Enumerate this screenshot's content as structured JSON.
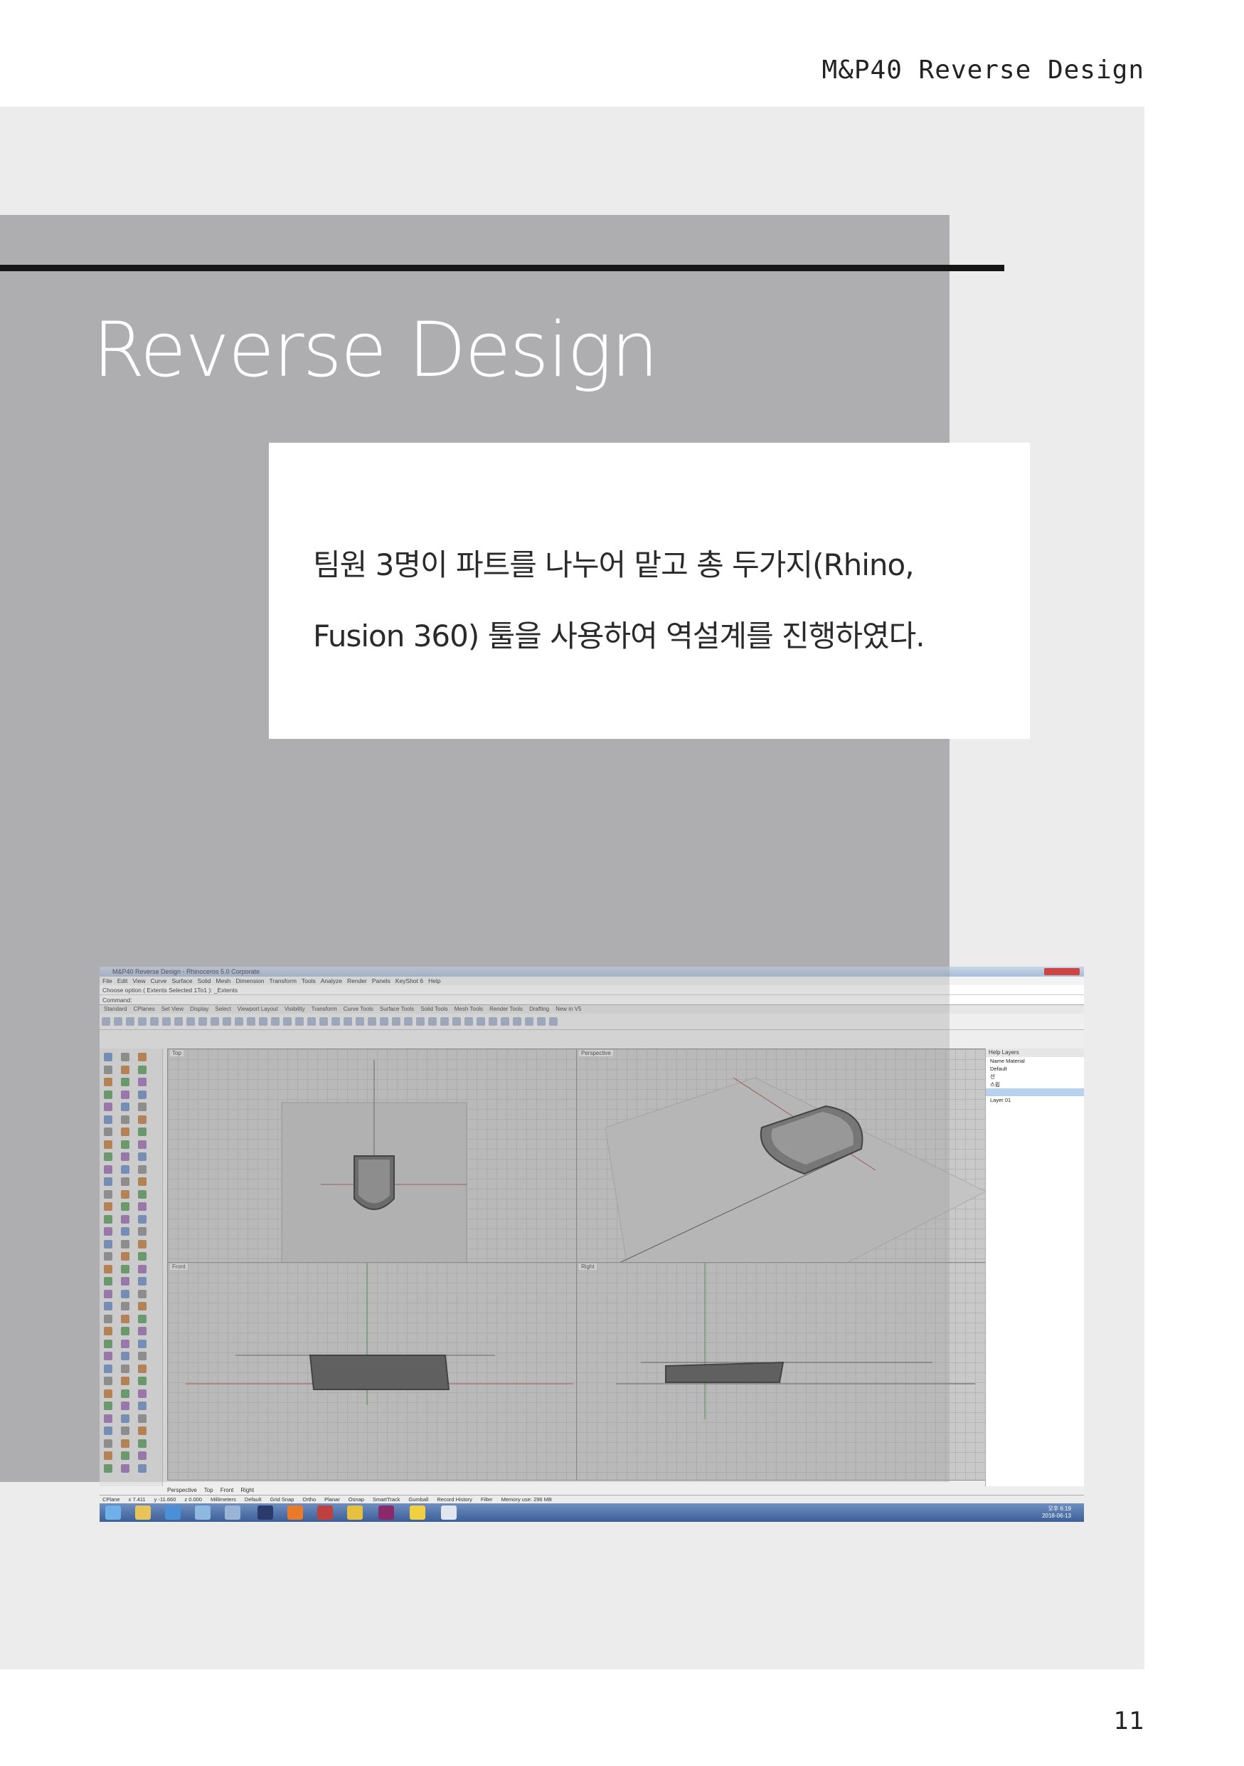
{
  "header": {
    "title": "M&P40 Reverse Design"
  },
  "section": {
    "title": "Reverse Design"
  },
  "body": {
    "line1": "팀원 3명이 파트를 나누어 맡고 총 두가지(Rhino,",
    "line2": "Fusion 360) 툴을 사용하여 역설계를 진행하였다."
  },
  "page_number": "11",
  "screenshot": {
    "window_title": "M&P40 Reverse Design - Rhinoceros 5.0 Corporate",
    "menu": [
      "File",
      "Edit",
      "View",
      "Curve",
      "Surface",
      "Solid",
      "Mesh",
      "Dimension",
      "Transform",
      "Tools",
      "Analyze",
      "Render",
      "Panels",
      "KeyShot 6",
      "Help"
    ],
    "command_history": "Choose option ( Extents  Selected  1To1 ): _Extents",
    "command_prompt": "Command:",
    "toolbar_tabs": [
      "Standard",
      "CPlanes",
      "Set View",
      "Display",
      "Select",
      "Viewport Layout",
      "Visibility",
      "Transform",
      "Curve Tools",
      "Surface Tools",
      "Solid Tools",
      "Mesh Tools",
      "Render Tools",
      "Drafting",
      "New in V5"
    ],
    "viewports": {
      "top": "Top",
      "perspective": "Perspective",
      "front": "Front",
      "right": "Right"
    },
    "viewport_tabs": [
      "Perspective",
      "Top",
      "Front",
      "Right"
    ],
    "panel": {
      "tabs": "Help  Layers",
      "columns": "Name   Material",
      "layers": [
        "Default",
        "선",
        "스윕",
        "",
        "Layer 01"
      ]
    },
    "status": [
      "CPlane",
      "x 7.411",
      "y -11.660",
      "z 0.000",
      "Millimeters",
      "Default",
      "Grid Snap",
      "Ortho",
      "Planar",
      "Osnap",
      "SmartTrack",
      "Gumball",
      "Record History",
      "Filter",
      "Memory use: 296 MB"
    ],
    "tray_time": "오후 6:19",
    "tray_date": "2018-06-13"
  }
}
